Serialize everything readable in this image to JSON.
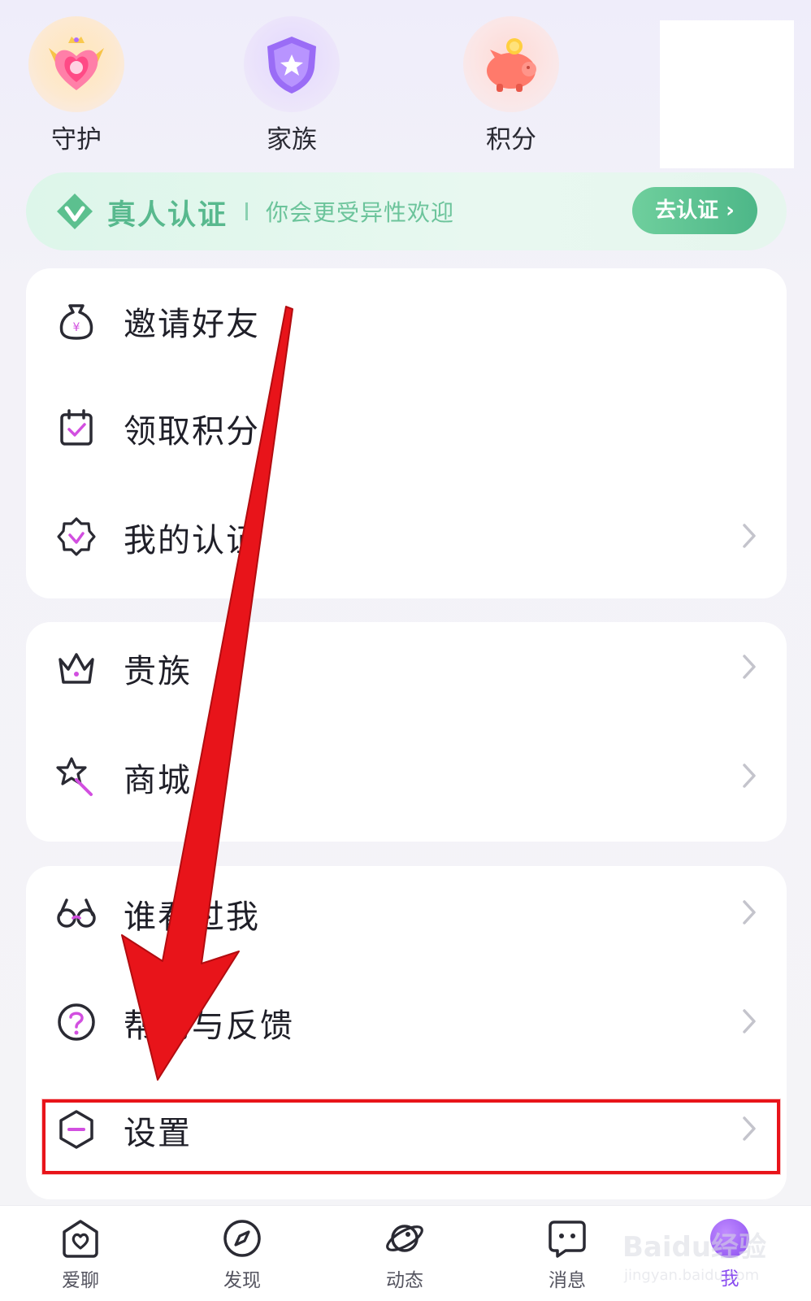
{
  "quick_entries": [
    {
      "label": "守护",
      "icon": "guard-heart-icon"
    },
    {
      "label": "家族",
      "icon": "family-shield-icon"
    },
    {
      "label": "积分",
      "icon": "piggy-bank-icon"
    }
  ],
  "verify_banner": {
    "title": "真人认证",
    "subtitle": "你会更受异性欢迎",
    "button": "去认证 ›",
    "accent": "#58b98e"
  },
  "menu_group_1": [
    {
      "label": "邀请好友",
      "icon": "money-bag-icon",
      "chevron": false
    },
    {
      "label": "领取积分",
      "icon": "calendar-check-icon",
      "chevron": false
    },
    {
      "label": "我的认证",
      "icon": "badge-check-icon",
      "chevron": true
    }
  ],
  "menu_group_2": [
    {
      "label": "贵族",
      "icon": "crown-icon",
      "chevron": true
    },
    {
      "label": "商城",
      "icon": "magic-wand-icon",
      "chevron": true
    }
  ],
  "menu_group_3": [
    {
      "label": "谁看过我",
      "icon": "glasses-icon",
      "chevron": true
    },
    {
      "label": "帮助与反馈",
      "icon": "help-circle-icon",
      "chevron": true
    },
    {
      "label": "设置",
      "icon": "settings-hexagon-icon",
      "chevron": true
    }
  ],
  "bottom_nav": [
    {
      "label": "爱聊",
      "icon": "home-heart-icon"
    },
    {
      "label": "发现",
      "icon": "compass-icon"
    },
    {
      "label": "动态",
      "icon": "planet-icon"
    },
    {
      "label": "消息",
      "icon": "chat-bubble-icon"
    },
    {
      "label": "我",
      "icon": "profile-icon",
      "active": true
    }
  ],
  "watermark": {
    "main": "Baidu经验",
    "sub": "jingyan.baidu.com"
  },
  "colors": {
    "annotation_red": "#e8141a",
    "active_purple": "#8a4cf0",
    "icon_accent": "#d24fe0"
  }
}
